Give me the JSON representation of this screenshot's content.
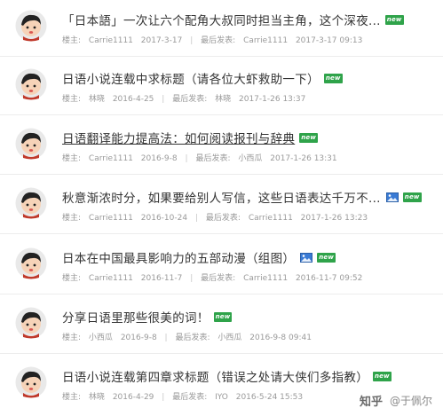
{
  "labels": {
    "owner": "楼主:",
    "last_reply": "最后发表:",
    "new_badge": "new"
  },
  "threads": [
    {
      "title": "「日本語」一次让六个配角大叔同时担当主角，这个深夜...",
      "underline": false,
      "has_image": false,
      "author": "Carrie1111",
      "date": "2017-3-17",
      "last_author": "Carrie1111",
      "last_time": "2017-3-17 09:13"
    },
    {
      "title": "日语小说连载中求标题（请各位大虾救助一下）",
      "underline": false,
      "has_image": false,
      "author": "林晓",
      "date": "2016-4-25",
      "last_author": "林晓",
      "last_time": "2017-1-26 13:37"
    },
    {
      "title": "日语翻译能力提高法：如何阅读报刊与辞典",
      "underline": true,
      "has_image": false,
      "author": "Carrie1111",
      "date": "2016-9-8",
      "last_author": "小西瓜",
      "last_time": "2017-1-26 13:31"
    },
    {
      "title": "秋意渐浓时分，如果要给别人写信，这些日语表达千万不...",
      "underline": false,
      "has_image": true,
      "author": "Carrie1111",
      "date": "2016-10-24",
      "last_author": "Carrie1111",
      "last_time": "2017-1-26 13:23"
    },
    {
      "title": "日本在中国最具影响力的五部动漫（组图）",
      "underline": false,
      "has_image": true,
      "author": "Carrie1111",
      "date": "2016-11-7",
      "last_author": "Carrie1111",
      "last_time": "2016-11-7 09:52"
    },
    {
      "title": "分享日语里那些很美的词！",
      "underline": false,
      "has_image": false,
      "author": "小西瓜",
      "date": "2016-9-8",
      "last_author": "小西瓜",
      "last_time": "2016-9-8 09:41"
    },
    {
      "title": "日语小说连载第四章求标题（错误之处请大侠们多指教）",
      "underline": false,
      "has_image": false,
      "author": "林晓",
      "date": "2016-4-29",
      "last_author": "IYO",
      "last_time": "2016-5-24 15:53"
    }
  ],
  "watermark": {
    "brand": "知乎",
    "user": "@于佩尔"
  },
  "colors": {
    "new_badge": "#2fa34a",
    "image_icon": "#3a7bd5",
    "meta_text": "#9a9a9a"
  }
}
